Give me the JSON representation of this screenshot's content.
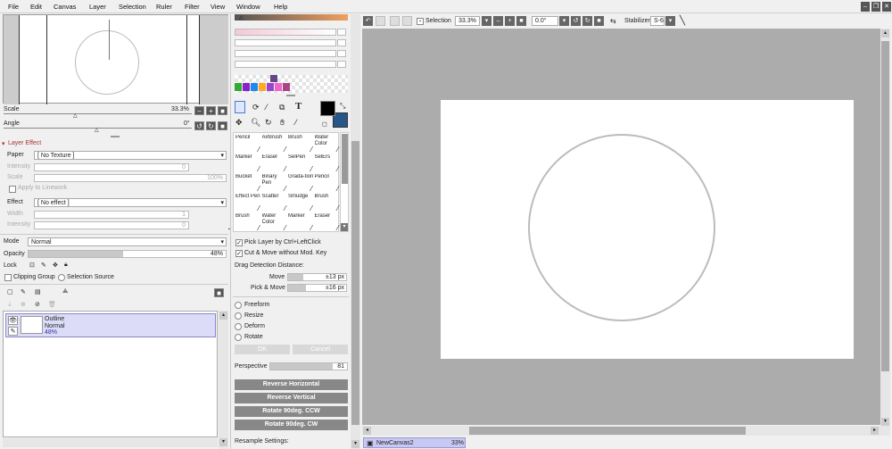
{
  "menu": [
    "File",
    "Edit",
    "Canvas",
    "Layer",
    "Selection",
    "Ruler",
    "Filter",
    "View",
    "Window",
    "Help"
  ],
  "nav": {
    "scale_label": "Scale",
    "scale_value": "33.3%",
    "angle_label": "Angle",
    "angle_value": "0°"
  },
  "layer_effect": {
    "header": "Layer Effect",
    "paper_label": "Paper",
    "paper_value": "[ No Texture ]",
    "intensity_label": "Intensity",
    "intensity_value": "0",
    "scale_label": "Scale",
    "scale_value": "100%",
    "apply_label": "Apply to Linework",
    "effect_label": "Effect",
    "effect_value": "[ No effect ]",
    "width_label": "Width",
    "width_value": "1",
    "intensity2_label": "Intensity",
    "intensity2_value": "0"
  },
  "layer_props": {
    "mode_label": "Mode",
    "mode_value": "Normal",
    "opacity_label": "Opacity",
    "opacity_value": "48%",
    "opacity_fraction": 0.48,
    "lock_label": "Lock",
    "clipping_label": "Clipping Group",
    "selection_source_label": "Selection Source"
  },
  "layers": [
    {
      "name": "Outline",
      "mode": "Normal",
      "opacity": "48%"
    }
  ],
  "tools": [
    [
      "Pencil",
      "AirBrush",
      "Brush",
      "Water Color"
    ],
    [
      "Marker",
      "Eraser",
      "SelPen",
      "SelErs"
    ],
    [
      "Bucket",
      "Binary Pen",
      "Grada-tion",
      "Pencil"
    ],
    [
      "Effect Pen",
      "Scatter",
      "Smudge",
      "Brush"
    ],
    [
      "Brush",
      "Water Color",
      "Marker",
      "Eraser"
    ]
  ],
  "swatch_colors": [
    "#33aa33",
    "#8822cc",
    "#2288ee",
    "#ffaa22",
    "#9944cc",
    "#ee66cc",
    "#aa4488"
  ],
  "colors": {
    "foreground": "#000000",
    "background": "#27578a",
    "accent": "#2a64c0"
  },
  "options": {
    "pick_layer_label": "Pick Layer by Ctrl+LeftClick",
    "cut_move_label": "Cut & Move without Mod. Key",
    "drag_detect_label": "Drag Detection Distance:",
    "move_label": "Move",
    "move_value": "±13 px",
    "pickmove_label": "Pick & Move",
    "pickmove_value": "±16 px",
    "transform_modes": [
      "Freeform",
      "Resize",
      "Deform",
      "Rotate"
    ],
    "ok_label": "OK",
    "cancel_label": "Cancel",
    "perspective_label": "Perspective",
    "perspective_value": "81",
    "buttons": [
      "Reverse Horizontal",
      "Reverse Vertical",
      "Rotate 90deg. CCW",
      "Rotate 90deg. CW"
    ],
    "resample_label": "Resample Settings:"
  },
  "toolbar": {
    "selection_label": "Selection",
    "zoom_value": "33.3%",
    "angle_value": "0.0°",
    "stabilizer_label": "Stabilizer",
    "stabilizer_value": "S-6"
  },
  "canvas_tab": {
    "name": "NewCanvas2",
    "zoom": "33%"
  }
}
